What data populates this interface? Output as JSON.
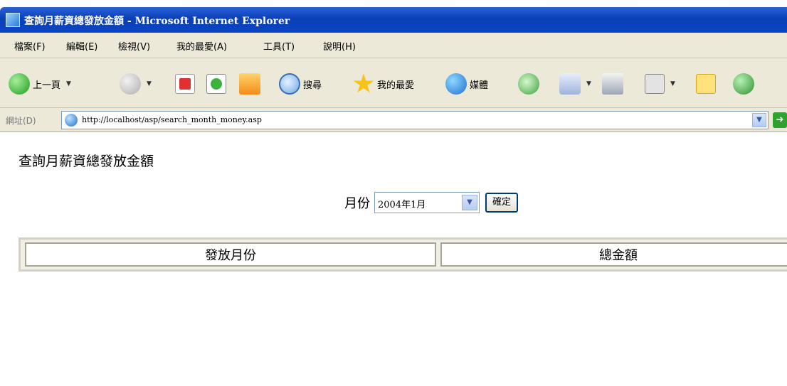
{
  "window": {
    "title": "查詢月薪資總發放金額 - Microsoft Internet Explorer"
  },
  "menu": {
    "items": [
      "檔案(F)",
      "編輯(E)",
      "檢視(V)",
      "我的最愛(A)",
      "工具(T)",
      "說明(H)"
    ]
  },
  "toolbar": {
    "back_label": "上一頁",
    "search_label": "搜尋",
    "favorites_label": "我的最愛",
    "media_label": "媒體"
  },
  "address": {
    "label": "網址(D)",
    "url": "http://localhost/asp/search_month_money.asp"
  },
  "page": {
    "heading": "查詢月薪資總發放金額",
    "month_label": "月份",
    "month_selected": "2004年1月",
    "submit_label": "確定",
    "table_headers": [
      "發放月份",
      "總金額"
    ]
  },
  "colors": {
    "titlebar": "#0a3fb5",
    "chrome": "#ece9d8"
  }
}
